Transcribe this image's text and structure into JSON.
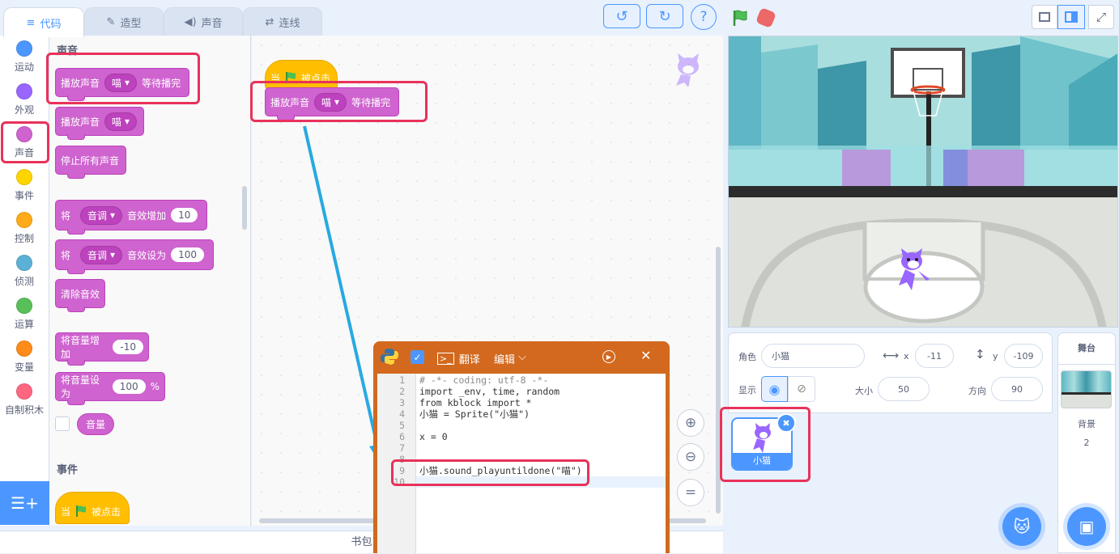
{
  "tabs": {
    "code": "代码",
    "costumes": "造型",
    "sounds": "声音",
    "connect": "连线"
  },
  "toolbar": {
    "help": "?"
  },
  "categories": [
    {
      "label": "运动",
      "color": "#4c97ff"
    },
    {
      "label": "外观",
      "color": "#9966ff"
    },
    {
      "label": "声音",
      "color": "#cf63cf"
    },
    {
      "label": "事件",
      "color": "#ffd500"
    },
    {
      "label": "控制",
      "color": "#ffab19"
    },
    {
      "label": "侦测",
      "color": "#5cb1d6"
    },
    {
      "label": "运算",
      "color": "#59c059"
    },
    {
      "label": "变量",
      "color": "#ff8c1a"
    },
    {
      "label": "自制积木",
      "color": "#ff6680"
    }
  ],
  "palette": {
    "section_sound": "声音",
    "play_until_done": "播放声音",
    "sound_name": "喵",
    "until_done_suffix": "等待播完",
    "play_sound": "播放声音",
    "stop_all": "停止所有声音",
    "set_prefix": "将",
    "effect_pitch": "音调",
    "effect_change_suffix": "音效增加",
    "effect_change_value": "10",
    "effect_set_suffix": "音效设为",
    "effect_set_value": "100",
    "clear_effects": "清除音效",
    "change_volume": "将音量增加",
    "change_volume_value": "-10",
    "set_volume": "将音量设为",
    "set_volume_value": "100",
    "percent": "%",
    "volume_reporter": "音量",
    "section_events": "事件",
    "when_flag_prefix": "当",
    "when_flag_suffix": "被点击"
  },
  "script": {
    "hat_prefix": "当",
    "hat_suffix": "被点击",
    "block_label": "播放声音",
    "block_sound": "喵",
    "block_suffix": "等待播完"
  },
  "editor": {
    "translate": "翻译",
    "edit": "编辑",
    "line_numbers": [
      "1",
      "2",
      "3",
      "4",
      "5",
      "6",
      "7",
      "8",
      "9",
      "10"
    ],
    "lines": [
      "# -*- coding: utf-8 -*-",
      "import _env, time, random",
      "from kblock import *",
      "小猫 = Sprite(\"小猫\")",
      "",
      "x = 0",
      "",
      "",
      "小猫.sound_playuntildone(\"喵\")",
      ""
    ]
  },
  "backpack": "书包",
  "sprite_info": {
    "sprite_label": "角色",
    "sprite_name": "小猫",
    "x_label": "x",
    "x_value": "-11",
    "y_label": "y",
    "y_value": "-109",
    "show_label": "显示",
    "size_label": "大小",
    "size_value": "50",
    "direction_label": "方向",
    "direction_value": "90"
  },
  "sprite_tile": {
    "name": "小猫"
  },
  "stage_panel": {
    "title": "舞台",
    "backdrops_label": "背景",
    "backdrops_count": "2"
  }
}
